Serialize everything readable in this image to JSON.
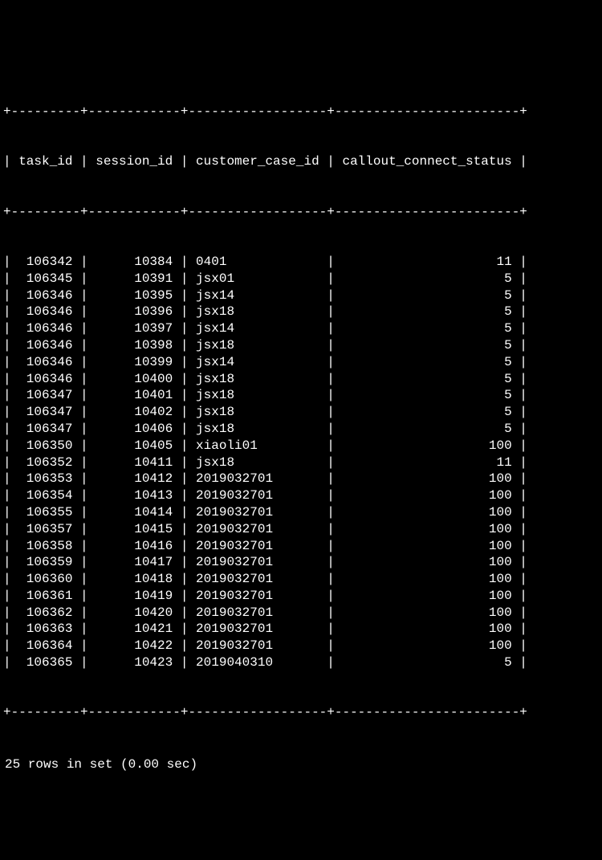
{
  "border": "+---------+------------+------------------+------------------------+",
  "header": {
    "task_id": "task_id",
    "session_id": "session_id",
    "customer_case_id": "customer_case_id",
    "callout_connect_status": "callout_connect_status"
  },
  "chart_data": {
    "type": "table",
    "columns": [
      "task_id",
      "session_id",
      "customer_case_id",
      "callout_connect_status"
    ],
    "rows": [
      {
        "task_id": "106342",
        "session_id": "10384",
        "customer_case_id": "0401",
        "callout_connect_status": "11"
      },
      {
        "task_id": "106345",
        "session_id": "10391",
        "customer_case_id": "jsx01",
        "callout_connect_status": "5"
      },
      {
        "task_id": "106346",
        "session_id": "10395",
        "customer_case_id": "jsx14",
        "callout_connect_status": "5"
      },
      {
        "task_id": "106346",
        "session_id": "10396",
        "customer_case_id": "jsx18",
        "callout_connect_status": "5"
      },
      {
        "task_id": "106346",
        "session_id": "10397",
        "customer_case_id": "jsx14",
        "callout_connect_status": "5"
      },
      {
        "task_id": "106346",
        "session_id": "10398",
        "customer_case_id": "jsx18",
        "callout_connect_status": "5"
      },
      {
        "task_id": "106346",
        "session_id": "10399",
        "customer_case_id": "jsx14",
        "callout_connect_status": "5"
      },
      {
        "task_id": "106346",
        "session_id": "10400",
        "customer_case_id": "jsx18",
        "callout_connect_status": "5"
      },
      {
        "task_id": "106347",
        "session_id": "10401",
        "customer_case_id": "jsx18",
        "callout_connect_status": "5"
      },
      {
        "task_id": "106347",
        "session_id": "10402",
        "customer_case_id": "jsx18",
        "callout_connect_status": "5"
      },
      {
        "task_id": "106347",
        "session_id": "10406",
        "customer_case_id": "jsx18",
        "callout_connect_status": "5"
      },
      {
        "task_id": "106350",
        "session_id": "10405",
        "customer_case_id": "xiaoli01",
        "callout_connect_status": "100"
      },
      {
        "task_id": "106352",
        "session_id": "10411",
        "customer_case_id": "jsx18",
        "callout_connect_status": "11"
      },
      {
        "task_id": "106353",
        "session_id": "10412",
        "customer_case_id": "2019032701",
        "callout_connect_status": "100"
      },
      {
        "task_id": "106354",
        "session_id": "10413",
        "customer_case_id": "2019032701",
        "callout_connect_status": "100"
      },
      {
        "task_id": "106355",
        "session_id": "10414",
        "customer_case_id": "2019032701",
        "callout_connect_status": "100"
      },
      {
        "task_id": "106357",
        "session_id": "10415",
        "customer_case_id": "2019032701",
        "callout_connect_status": "100"
      },
      {
        "task_id": "106358",
        "session_id": "10416",
        "customer_case_id": "2019032701",
        "callout_connect_status": "100"
      },
      {
        "task_id": "106359",
        "session_id": "10417",
        "customer_case_id": "2019032701",
        "callout_connect_status": "100"
      },
      {
        "task_id": "106360",
        "session_id": "10418",
        "customer_case_id": "2019032701",
        "callout_connect_status": "100"
      },
      {
        "task_id": "106361",
        "session_id": "10419",
        "customer_case_id": "2019032701",
        "callout_connect_status": "100"
      },
      {
        "task_id": "106362",
        "session_id": "10420",
        "customer_case_id": "2019032701",
        "callout_connect_status": "100"
      },
      {
        "task_id": "106363",
        "session_id": "10421",
        "customer_case_id": "2019032701",
        "callout_connect_status": "100"
      },
      {
        "task_id": "106364",
        "session_id": "10422",
        "customer_case_id": "2019032701",
        "callout_connect_status": "100"
      },
      {
        "task_id": "106365",
        "session_id": "10423",
        "customer_case_id": "2019040310",
        "callout_connect_status": "5"
      }
    ]
  },
  "footer": "25 rows in set (0.00 sec)",
  "col_widths": {
    "task_id": 9,
    "session_id": 12,
    "customer_case_id": 18,
    "callout_connect_status": 24
  },
  "alignment": {
    "task_id": "right",
    "session_id": "right",
    "customer_case_id": "left",
    "callout_connect_status": "right"
  }
}
